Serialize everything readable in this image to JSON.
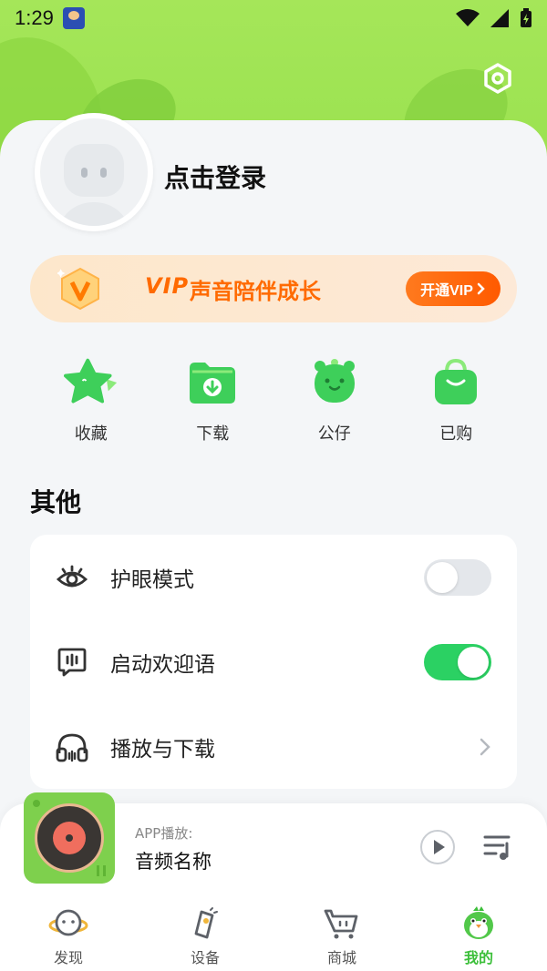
{
  "status_bar": {
    "time": "1:29"
  },
  "profile": {
    "login_text": "点击登录"
  },
  "vip": {
    "label": "VIP",
    "slogan": "声音陪伴成长",
    "open_button": "开通VIP"
  },
  "quick_actions": [
    {
      "label": "收藏",
      "icon": "star-icon"
    },
    {
      "label": "下载",
      "icon": "download-folder-icon"
    },
    {
      "label": "公仔",
      "icon": "toy-figure-icon"
    },
    {
      "label": "已购",
      "icon": "shopping-bag-icon"
    }
  ],
  "other": {
    "title": "其他",
    "items": [
      {
        "label": "护眼模式",
        "icon": "eye-icon",
        "control": "toggle",
        "enabled": false
      },
      {
        "label": "启动欢迎语",
        "icon": "voice-message-icon",
        "control": "toggle",
        "enabled": true
      },
      {
        "label": "播放与下载",
        "icon": "headphones-icon",
        "control": "chevron"
      }
    ]
  },
  "player": {
    "source": "APP播放:",
    "title": "音频名称"
  },
  "tabs": [
    {
      "label": "发现",
      "icon": "planet-icon",
      "active": false
    },
    {
      "label": "设备",
      "icon": "device-icon",
      "active": false
    },
    {
      "label": "商城",
      "icon": "shopping-cart-icon",
      "active": false
    },
    {
      "label": "我的",
      "icon": "bird-mascot-icon",
      "active": true
    }
  ],
  "colors": {
    "header_green": "#96e04c",
    "vip_orange": "#ff6a00",
    "toggle_on": "#2bd163",
    "tab_active": "#3cbf3a",
    "icon_green": "#3ecf5a"
  }
}
